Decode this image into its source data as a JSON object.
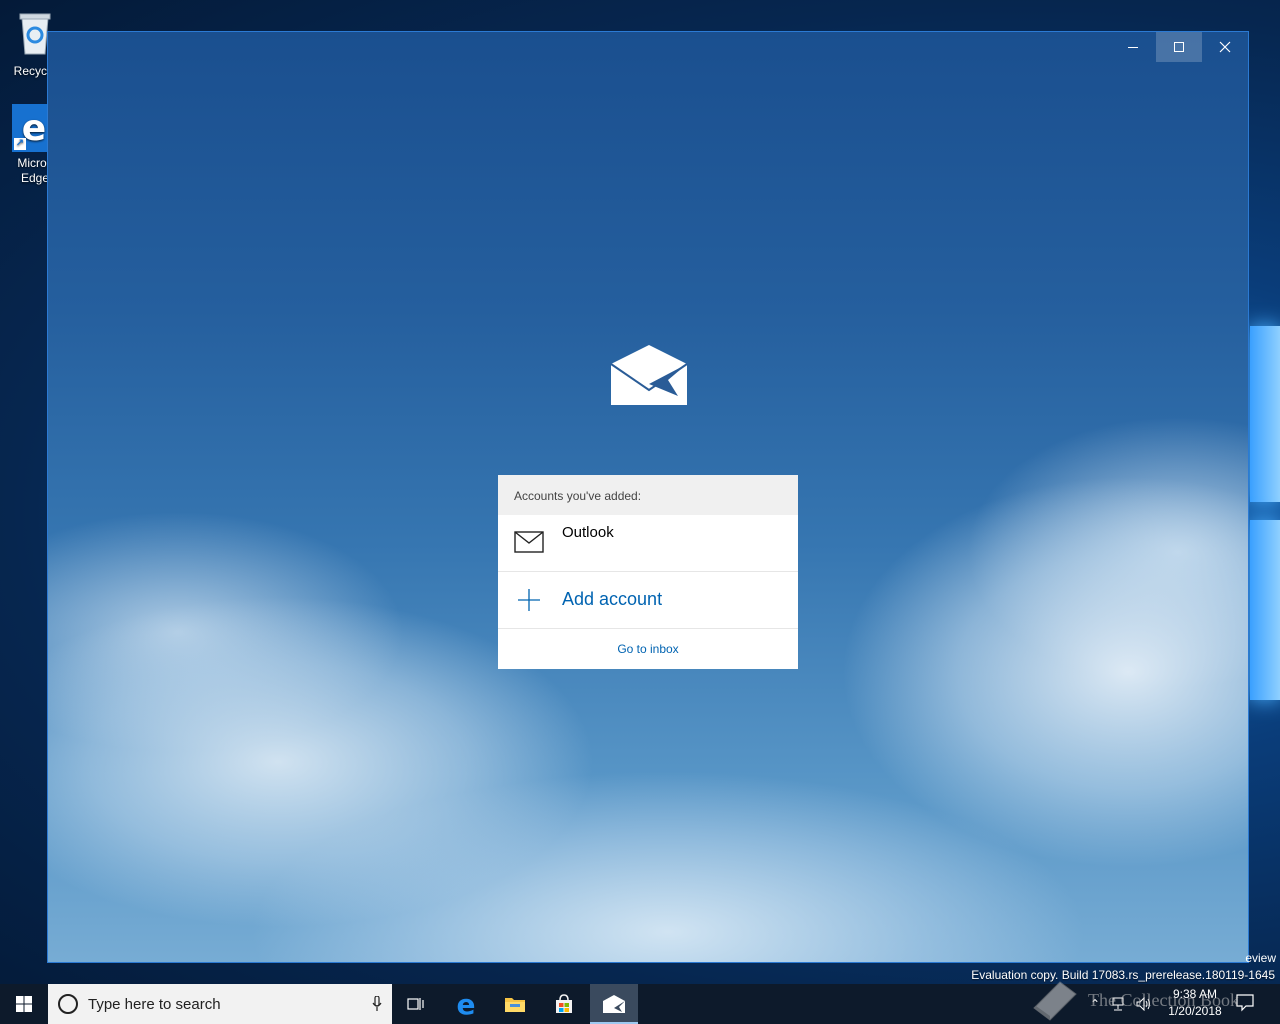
{
  "desktop": {
    "icons": [
      {
        "label": "Recycle"
      },
      {
        "label": "Micros\nEdge"
      }
    ]
  },
  "mail_window": {
    "controls": {
      "minimize": "minimize",
      "maximize": "maximize",
      "close": "close"
    },
    "accounts_panel": {
      "header": "Accounts you've added:",
      "accounts": [
        {
          "name": "Outlook"
        }
      ],
      "add_account": "Add account",
      "go_to_inbox": "Go to inbox"
    }
  },
  "watermark": {
    "preview": "eview",
    "evaluation": "Evaluation copy. Build 17083.rs_prerelease.180119-1645",
    "collection_book": "The Collection Book"
  },
  "taskbar": {
    "search_placeholder": "Type here to search",
    "clock_time": "9:38 AM",
    "clock_date": "1/20/2018",
    "apps": [
      "task-view",
      "edge",
      "file-explorer",
      "store",
      "mail"
    ]
  },
  "colors": {
    "accent": "#0063b1",
    "taskbar": "#0d1a2b"
  }
}
